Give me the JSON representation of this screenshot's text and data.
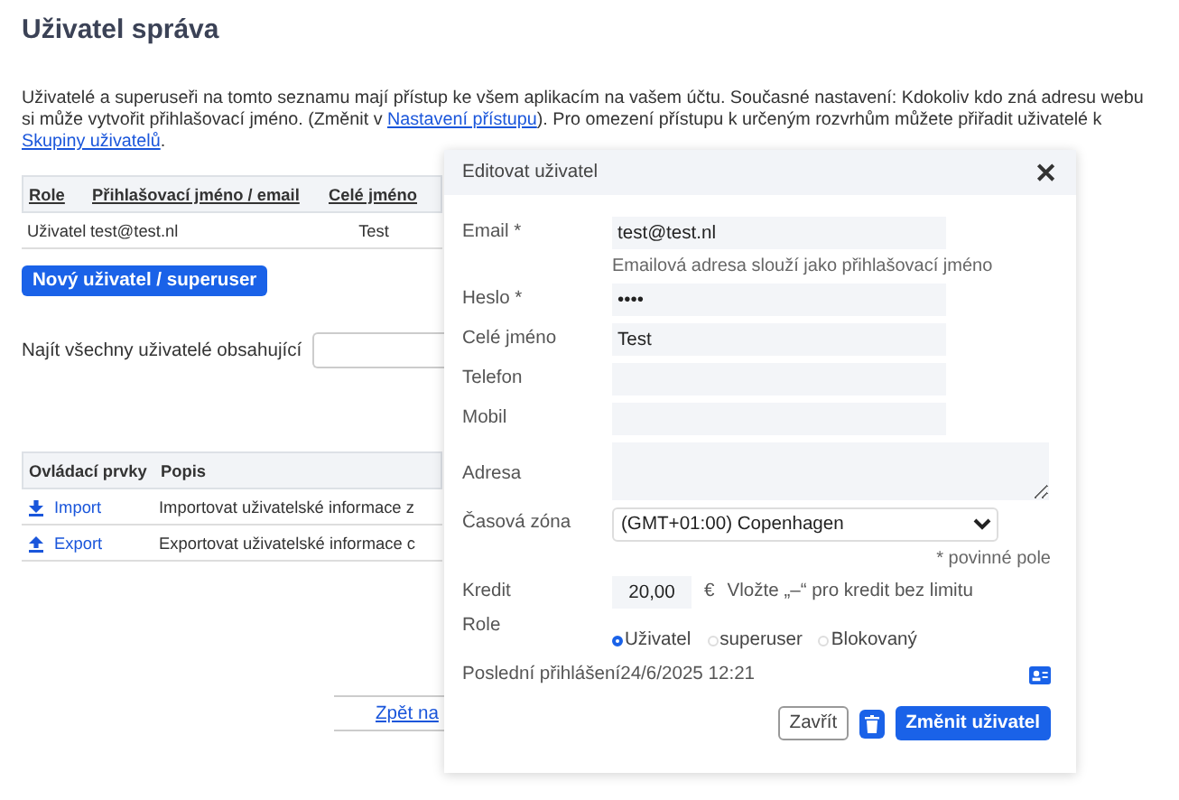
{
  "title": "Uživatel správa",
  "intro": {
    "before": "Uživatelé a superuseři na tomto seznamu mají přístup ke všem aplikacím na vašem účtu. Současné nastavení: Kdokoliv kdo zná adresu webu si může vytvořit přihlašovací jméno. (Změnit v ",
    "link1": "Nastavení přístupu",
    "middle": "). Pro omezení přístupu k určeným rozvrhům můžete přiřadit uživatelé k ",
    "link2": "Skupiny uživatelů",
    "after": "."
  },
  "users_table": {
    "columns": [
      "Role",
      "Přihlašovací jméno / email",
      "Celé jméno"
    ],
    "rows": [
      [
        "Uživatel",
        "test@test.nl",
        "Test"
      ]
    ]
  },
  "new_user_button": "Nový uživatel / superuser",
  "search": {
    "label": "Najít všechny uživatelé obsahující"
  },
  "controls_table": {
    "columns": [
      "Ovládací prvky",
      "Popis"
    ],
    "rows": [
      {
        "kind": "import",
        "action": "Import",
        "description": "Importovat uživatelské informace z"
      },
      {
        "kind": "export",
        "action": "Export",
        "description": "Exportovat uživatelské informace c"
      }
    ]
  },
  "back_link": "Zpět na",
  "dialog": {
    "title": "Editovat uživatel",
    "close": "✕",
    "fields": [
      {
        "kind": "input",
        "label": "Email *",
        "value": "test@test.nl",
        "hint": "Emailová adresa slouží jako přihlašovací jméno"
      },
      {
        "kind": "input",
        "label": "Heslo *",
        "value": "••••"
      },
      {
        "kind": "input",
        "label": "Celé jméno",
        "value": "Test"
      },
      {
        "kind": "input",
        "label": "Telefon"
      },
      {
        "kind": "input",
        "label": "Mobil"
      },
      {
        "kind": "textarea",
        "label": "Adresa"
      },
      {
        "kind": "select",
        "label": "Časová zóna",
        "value": "(GMT+01:00) Copenhagen"
      }
    ],
    "required_note": "* povinné pole",
    "credit": {
      "label": "Kredit",
      "value": "20,00",
      "currency": "€",
      "hint": "Vložte „–“ pro kredit bez limitu"
    },
    "role": {
      "label": "Role",
      "options": [
        {
          "label": "Uživatel",
          "selected": true
        },
        {
          "label": "superuser",
          "selected": false
        },
        {
          "label": "Blokovaný",
          "selected": false
        }
      ]
    },
    "last_login": {
      "label": "Poslední přihlášení",
      "value": "24/6/2025 12:21"
    },
    "buttons": {
      "close": "Zavřít",
      "submit": "Změnit uživatel"
    }
  }
}
